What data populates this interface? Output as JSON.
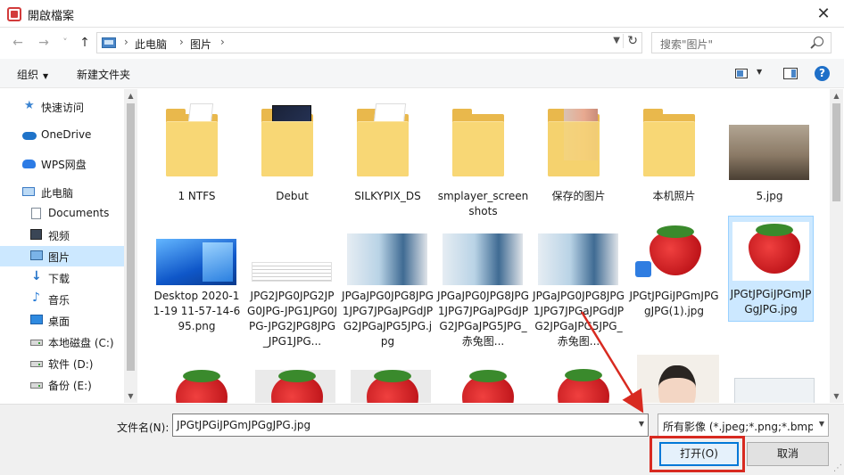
{
  "window": {
    "title": "開啟檔案",
    "close_glyph": "✕"
  },
  "nav": {
    "back_glyph": "←",
    "forward_glyph": "→",
    "recent_glyph": "˅",
    "up_glyph": "↑",
    "breadcrumb": [
      "此电脑",
      "图片"
    ],
    "crumb_sep": "›",
    "refresh_glyph": "↻",
    "search_placeholder": "搜索\"图片\""
  },
  "toolbar": {
    "organize": "组织",
    "new_folder": "新建文件夹",
    "help": "?"
  },
  "sidebar": {
    "items": [
      {
        "label": "快速访问",
        "icon": "star-icon"
      },
      {
        "label": "OneDrive",
        "icon": "cloud-icon"
      },
      {
        "label": "WPS网盘",
        "icon": "wps-cloud-icon"
      },
      {
        "label": "此电脑",
        "icon": "computer-icon"
      },
      {
        "label": "Documents",
        "icon": "document-icon"
      },
      {
        "label": "视频",
        "icon": "video-icon"
      },
      {
        "label": "图片",
        "icon": "picture-icon",
        "selected": true
      },
      {
        "label": "下载",
        "icon": "download-icon"
      },
      {
        "label": "音乐",
        "icon": "music-icon"
      },
      {
        "label": "桌面",
        "icon": "desktop-icon"
      },
      {
        "label": "本地磁盘 (C:)",
        "icon": "drive-icon"
      },
      {
        "label": "软件 (D:)",
        "icon": "drive-icon"
      },
      {
        "label": "备份 (E:)",
        "icon": "drive-icon"
      }
    ]
  },
  "files": {
    "row1": [
      {
        "name": "1 NTFS",
        "kind": "folder"
      },
      {
        "name": "Debut",
        "kind": "folder"
      },
      {
        "name": "SILKYPIX_DS",
        "kind": "folder"
      },
      {
        "name": "smplayer_screenshots",
        "kind": "folder"
      },
      {
        "name": "保存的图片",
        "kind": "folder"
      },
      {
        "name": "本机照片",
        "kind": "folder"
      },
      {
        "name": "5.jpg",
        "kind": "image"
      }
    ],
    "row2": [
      {
        "name": "Desktop 2020-11-19 11-57-14-695.png",
        "kind": "image"
      },
      {
        "name": "JPG2JPG0JPG2JPG0JPG-JPG1JPG0JPG-JPG2JPG8JPG_JPG1JPG...",
        "kind": "image"
      },
      {
        "name": "JPGaJPG0JPG8JPG1JPG7JPGaJPGdJPG2JPGaJPG5JPG.jpg",
        "kind": "image"
      },
      {
        "name": "JPGaJPG0JPG8JPG1JPG7JPGaJPGdJPG2JPGaJPG5JPG_赤兔图...",
        "kind": "image"
      },
      {
        "name": "JPGaJPG0JPG8JPG1JPG7JPGaJPGdJPG2JPGaJPG5JPG_赤兔图...",
        "kind": "image"
      },
      {
        "name": "JPGtJPGiJPGmJPGgJPG(1).jpg",
        "kind": "image"
      },
      {
        "name": "JPGtJPGiJPGmJPGgJPG.jpg",
        "kind": "image",
        "selected": true
      }
    ]
  },
  "bottom": {
    "filename_label": "文件名(N):",
    "filename_value": "JPGtJPGiJPGmJPGgJPG.jpg",
    "filter_value": "所有影像 (*.jpeg;*.png;*.bmp;",
    "open_label": "打开(O)",
    "cancel_label": "取消"
  },
  "colors": {
    "selection": "#cce8ff",
    "accent": "#0078d7",
    "highlight": "#d82a20"
  }
}
